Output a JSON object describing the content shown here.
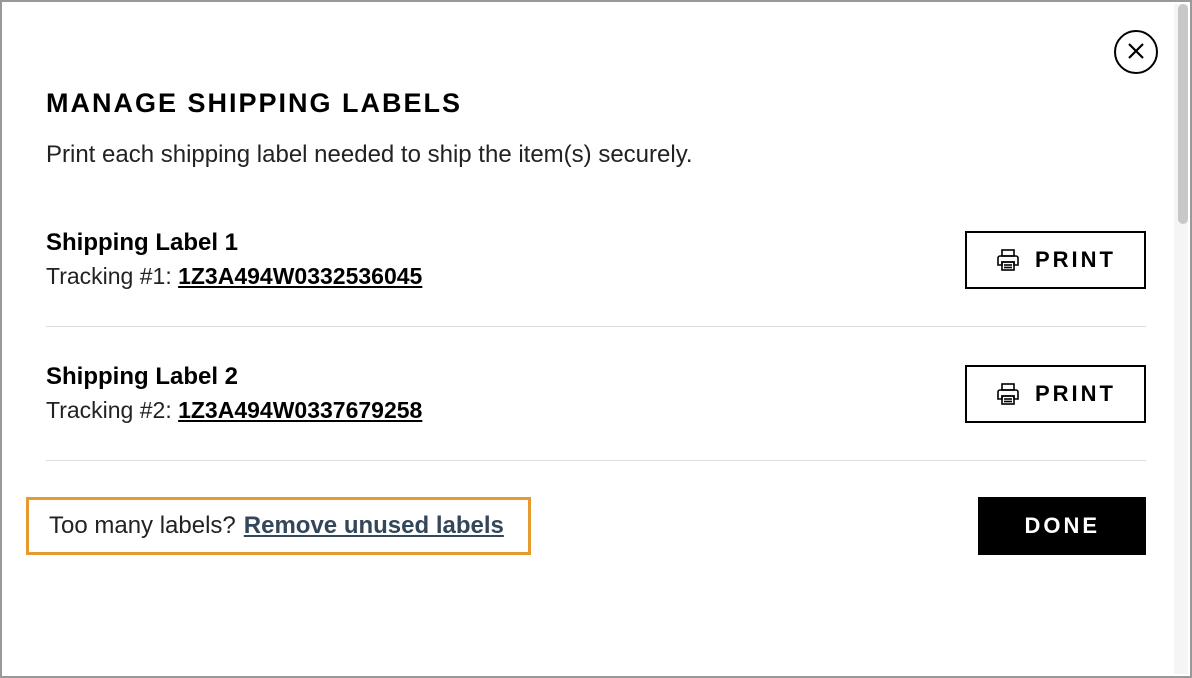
{
  "modal": {
    "title": "MANAGE SHIPPING LABELS",
    "subtitle": "Print each shipping label needed to ship the item(s) securely."
  },
  "labels": [
    {
      "name": "Shipping Label 1",
      "tracking_prefix": "Tracking #1: ",
      "tracking_number": "1Z3A494W0332536045",
      "print_label": "PRINT"
    },
    {
      "name": "Shipping Label 2",
      "tracking_prefix": "Tracking #2: ",
      "tracking_number": "1Z3A494W0337679258",
      "print_label": "PRINT"
    }
  ],
  "footer": {
    "too_many_text": "Too many labels?",
    "remove_link_text": "Remove unused labels",
    "done_label": "DONE"
  }
}
